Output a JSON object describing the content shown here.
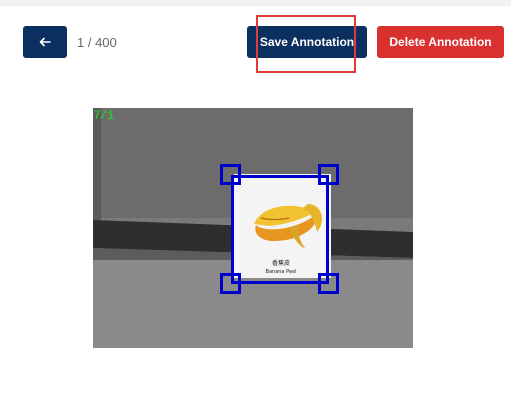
{
  "toolbar": {
    "back_icon": "arrow-left-icon",
    "page_indicator": "1 / 400",
    "save_label": "Save Annotation",
    "delete_label": "Delete Annotation"
  },
  "image": {
    "overlay_counter": "7/1",
    "card_label_cn": "香蕉皮",
    "card_label_en": "Banana Peel"
  },
  "colors": {
    "primary": "#0b2f5e",
    "danger": "#d93030",
    "highlight": "#e03a3a",
    "bbox": "#0000cc",
    "counter": "#22dd22"
  }
}
